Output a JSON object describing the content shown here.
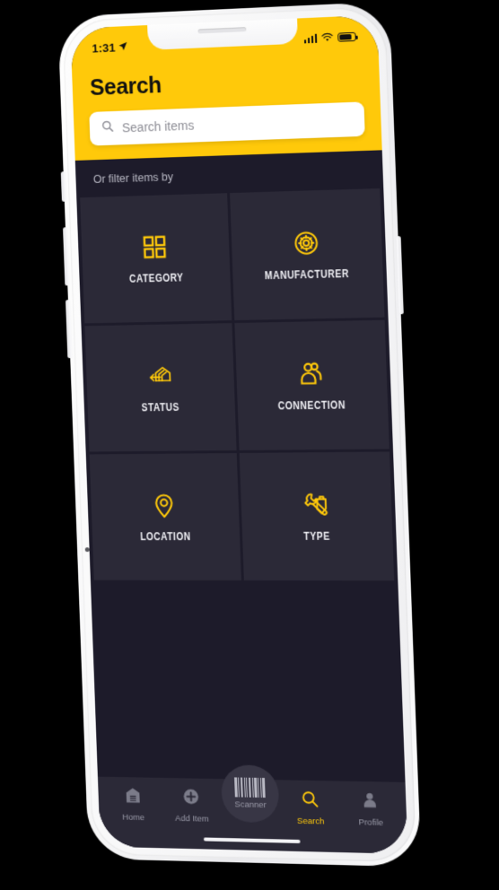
{
  "status_bar": {
    "time": "1:31",
    "location_icon": "location-arrow-icon",
    "signal_icon": "cellular-signal-icon",
    "wifi_icon": "wifi-icon",
    "battery_icon": "battery-icon"
  },
  "header": {
    "title": "Search",
    "search": {
      "placeholder": "Search items",
      "value": "",
      "icon": "search-icon"
    },
    "background_color": "#FFC90A"
  },
  "main": {
    "filter_label": "Or filter items by",
    "tiles": [
      {
        "label": "CATEGORY",
        "icon": "grid-squares-icon"
      },
      {
        "label": "MANUFACTURER",
        "icon": "gear-circle-icon"
      },
      {
        "label": "STATUS",
        "icon": "warehouse-arrow-icon"
      },
      {
        "label": "CONNECTION",
        "icon": "two-people-icon"
      },
      {
        "label": "LOCATION",
        "icon": "map-pin-icon"
      },
      {
        "label": "TYPE",
        "icon": "wrench-toolbox-icon"
      }
    ],
    "tile_color": "#2b2937",
    "background_color": "#1d1b2a",
    "accent_color": "#FFC90A"
  },
  "bottom_nav": {
    "items": [
      {
        "label": "Home",
        "icon": "warehouse-home-icon",
        "active": false
      },
      {
        "label": "Add Item",
        "icon": "plus-circle-icon",
        "active": false
      },
      {
        "label": "Scanner",
        "icon": "barcode-icon",
        "active": false
      },
      {
        "label": "Search",
        "icon": "search-icon",
        "active": true
      },
      {
        "label": "Profile",
        "icon": "person-icon",
        "active": false
      }
    ],
    "active_color": "#FFC90A",
    "inactive_color": "#9a9aa8"
  }
}
